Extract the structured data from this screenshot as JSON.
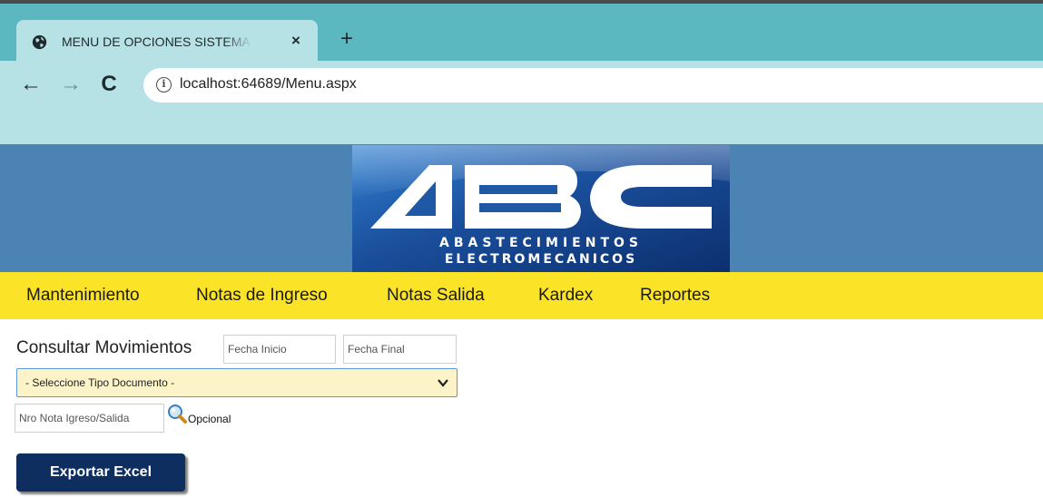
{
  "browser": {
    "tab_title": "MENU DE OPCIONES SISTEMA LUBRI",
    "tab_close": "×",
    "new_tab": "+",
    "url": "localhost:64689/Menu.aspx",
    "info_glyph": "i",
    "back_glyph": "←",
    "forward_glyph": "→",
    "reload_glyph": "C"
  },
  "logo": {
    "big_letters": "ABC",
    "line1": "ABASTECIMIENTOS",
    "line2": "ELECTROMECANICOS"
  },
  "menu": {
    "items": [
      "Mantenimiento",
      "Notas de Ingreso",
      "Notas Salida",
      "Kardex",
      "Reportes"
    ]
  },
  "form": {
    "title": "Consultar Movimientos",
    "fecha_inicio_placeholder": "Fecha Inicio",
    "fecha_final_placeholder": "Fecha Final",
    "tipo_documento_selected": "- Seleccione Tipo Documento -",
    "nro_nota_placeholder": "Nro Nota Igreso/Salida",
    "opcional_label": "Opcional",
    "export_label": "Exportar Excel"
  },
  "icons": [
    "globe-icon",
    "close-icon",
    "plus-icon",
    "back-arrow-icon",
    "forward-arrow-icon",
    "reload-icon",
    "info-icon",
    "chevron-down-icon",
    "search-icon"
  ],
  "colors": {
    "tabstrip": "#5bb8c0",
    "toolbar": "#b6e1e5",
    "banner": "#4a83b4",
    "menubar": "#fbe428",
    "select_bg": "#fcf4c8",
    "export_button": "#0e2e5f"
  }
}
